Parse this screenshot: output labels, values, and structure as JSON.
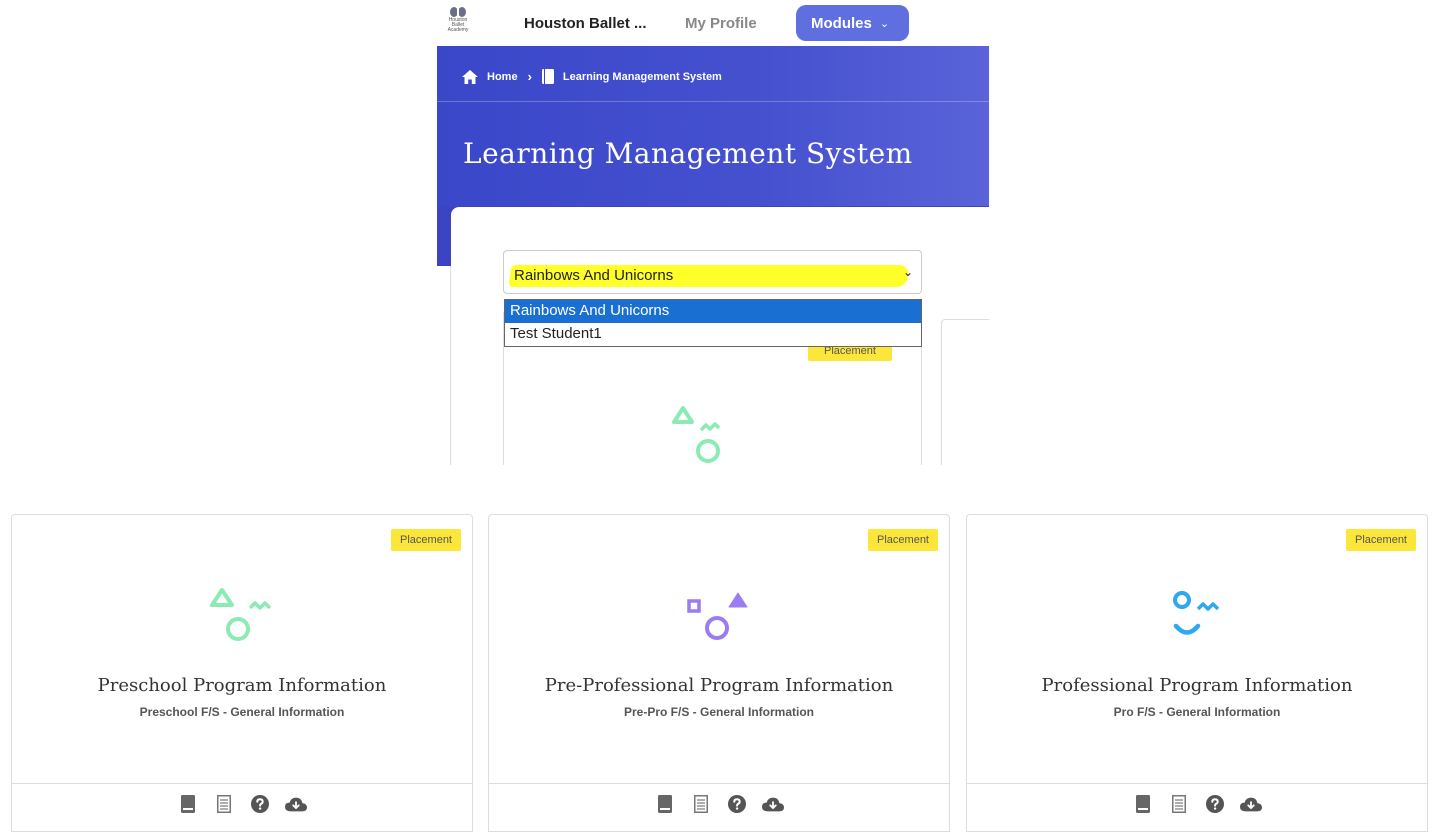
{
  "navbar": {
    "logo_text": [
      "Houston Ballet",
      "Academy"
    ],
    "title": "Houston Ballet ...",
    "profile_link": "My Profile",
    "modules_button": "Modules",
    "modules_chevron": "⌄"
  },
  "breadcrumb": {
    "home": "Home",
    "separator": "›",
    "current": "Learning Management System"
  },
  "hero": {
    "title": "Learning Management System"
  },
  "student_select": {
    "value": "Rainbows And Unicorns",
    "chevron": "⌄",
    "options": [
      {
        "label": "Rainbows And Unicorns",
        "selected": true
      },
      {
        "label": "Test Student1",
        "selected": false
      }
    ]
  },
  "mini_card": {
    "badge": "Placement"
  },
  "cards": [
    {
      "badge": "Placement",
      "title": "Preschool Program Information",
      "subtitle": "Preschool F/S - General Information",
      "accent": "#8cebb2",
      "icon": "triangle-circle-zigzag-icon"
    },
    {
      "badge": "Placement",
      "title": "Pre-Professional Program Information",
      "subtitle": "Pre-Pro F/S - General Information",
      "accent": "#9b7cf2",
      "icon": "square-circle-triangle-icon"
    },
    {
      "badge": "Placement",
      "title": "Professional Program Information",
      "subtitle": "Pro F/S - General Information",
      "accent": "#2fa8f0",
      "icon": "circle-zigzag-smile-icon"
    }
  ],
  "card_actions": [
    "book-icon",
    "notepad-icon",
    "help-circle-icon",
    "cloud-download-icon"
  ],
  "colors": {
    "brand_blue": "#3a47c9",
    "modules_button": "#5f6fe0",
    "badge_yellow": "#fde63a",
    "select_highlight": "#ffff2a",
    "dropdown_selected": "#1a6fd3"
  }
}
